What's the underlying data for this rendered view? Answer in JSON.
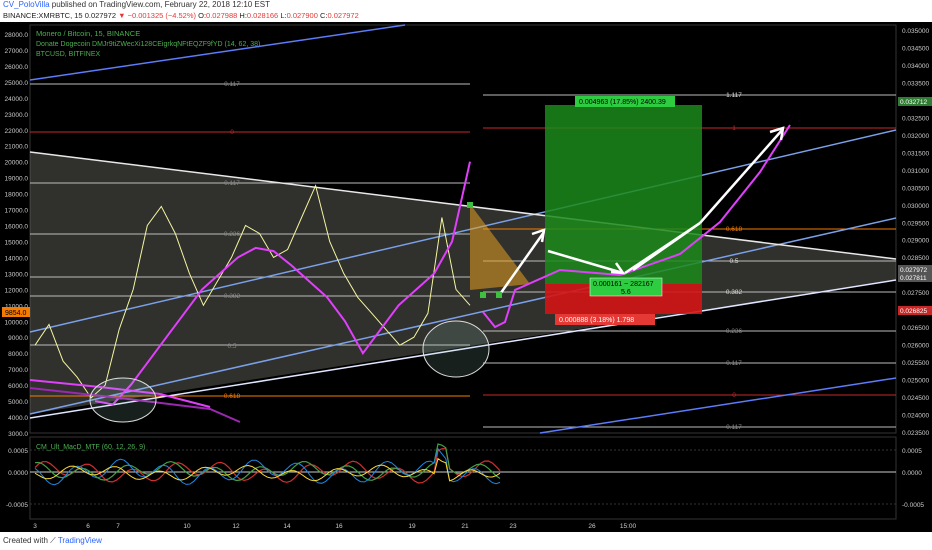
{
  "header": {
    "user": "CV_PoloVilla",
    "published": "published on TradingView.com, February 22, 2018 12:10 EST"
  },
  "infobar": {
    "symbol": "BINANCE:XMRBTC, 15",
    "last": "0.027972",
    "arrow": "▼",
    "change": "−0.001325 (−4.52%)",
    "o_label": "O:",
    "o_val": "0.027988",
    "h_label": "H:",
    "h_val": "0.028166",
    "l_label": "L:",
    "l_val": "0.027900",
    "c_label": "C:",
    "c_val": "0.027972"
  },
  "legend": {
    "main": "Monero / Bitcoin, 15, BINANCE",
    "donate": "Donate Dogecoin DMJr9tiZWecXi128CEigrkqNFtEQZF9fYD (14, 62, 38)",
    "btc": "BTCUSD, BITFINEX",
    "macd": "CM_Ult_MacD_MTF (60, 12, 26, 9)"
  },
  "footer": {
    "created": "Created with",
    "brand": "TradingView"
  },
  "chart_data": {
    "type": "line",
    "title": "Monero / Bitcoin, 15, BINANCE",
    "left_axis": {
      "ticks": [
        "28000.0",
        "27000.0",
        "26000.0",
        "25000.0",
        "24000.0",
        "23000.0",
        "22000.0",
        "21000.0",
        "20000.0",
        "19000.0",
        "18000.0",
        "17000.0",
        "16000.0",
        "15000.0",
        "14000.0",
        "13000.0",
        "12000.0",
        "11000.0",
        "10000.0",
        "9000.0",
        "8000.0",
        "7000.0",
        "6000.0",
        "5000.0",
        "4000.0",
        "3000.0"
      ],
      "current": "9854.0"
    },
    "right_axis": {
      "ticks": [
        "0.035000",
        "0.034500",
        "0.034000",
        "0.033500",
        "0.033000",
        "0.032500",
        "0.032000",
        "0.031500",
        "0.031000",
        "0.030500",
        "0.030000",
        "0.029500",
        "0.029000",
        "0.028500",
        "0.028000",
        "0.027500",
        "0.027000",
        "0.026500",
        "0.026000",
        "0.025500",
        "0.025000",
        "0.024500",
        "0.024000",
        "0.023500"
      ],
      "price_tags": [
        {
          "text": "0.032712",
          "color": "#2e7d32"
        },
        {
          "text": "0.027972",
          "color": "#555555"
        },
        {
          "text": "0.027811",
          "color": "#555555"
        },
        {
          "text": "0.026825",
          "color": "#c62828"
        }
      ]
    },
    "macd_axis": [
      "0.0005",
      "0.0000",
      "-0.0005"
    ],
    "macd_right_axis": [
      "0.0005",
      "0.0000",
      "-0.0005"
    ],
    "x_ticks": [
      "3",
      "6",
      "7",
      "10",
      "12",
      "14",
      "16",
      "19",
      "21",
      "23",
      "26",
      "15:00"
    ],
    "fib_left": [
      "0.117",
      "0",
      "0.117",
      "0.236",
      "0.382",
      "0.5",
      "0.618"
    ],
    "fib_right": [
      "1.117",
      "1",
      "0.618",
      "0.5",
      "0.382",
      "0.236",
      "0.117",
      "0",
      "0.117"
    ],
    "position": {
      "target": "0.004963 (17.85%) 2400.39",
      "stop": "0.000888 (3.18%) 1.798",
      "entry": "0.000161 ~ 282167",
      "ratio": "5.6"
    },
    "series": [
      {
        "color": "#f5f5a0",
        "values": [
          8500,
          9800,
          7500,
          6500,
          5200,
          6000,
          9500,
          12000,
          16000,
          17200,
          15500,
          13000,
          11000,
          12500,
          14000,
          16000,
          15500,
          14000,
          14500,
          16500,
          18500,
          15000,
          13000,
          11500,
          10500,
          9500,
          8500,
          9000,
          10500,
          16500,
          12000,
          11000
        ]
      },
      {
        "color": "#e040fb",
        "values": [
          5000,
          4800,
          6000,
          7500,
          9000,
          10500,
          12000,
          13000,
          14000,
          14600,
          14400,
          13500,
          12500,
          11500,
          10000,
          8000,
          9500,
          11000,
          12000,
          13000,
          15000,
          20000
        ]
      }
    ]
  }
}
